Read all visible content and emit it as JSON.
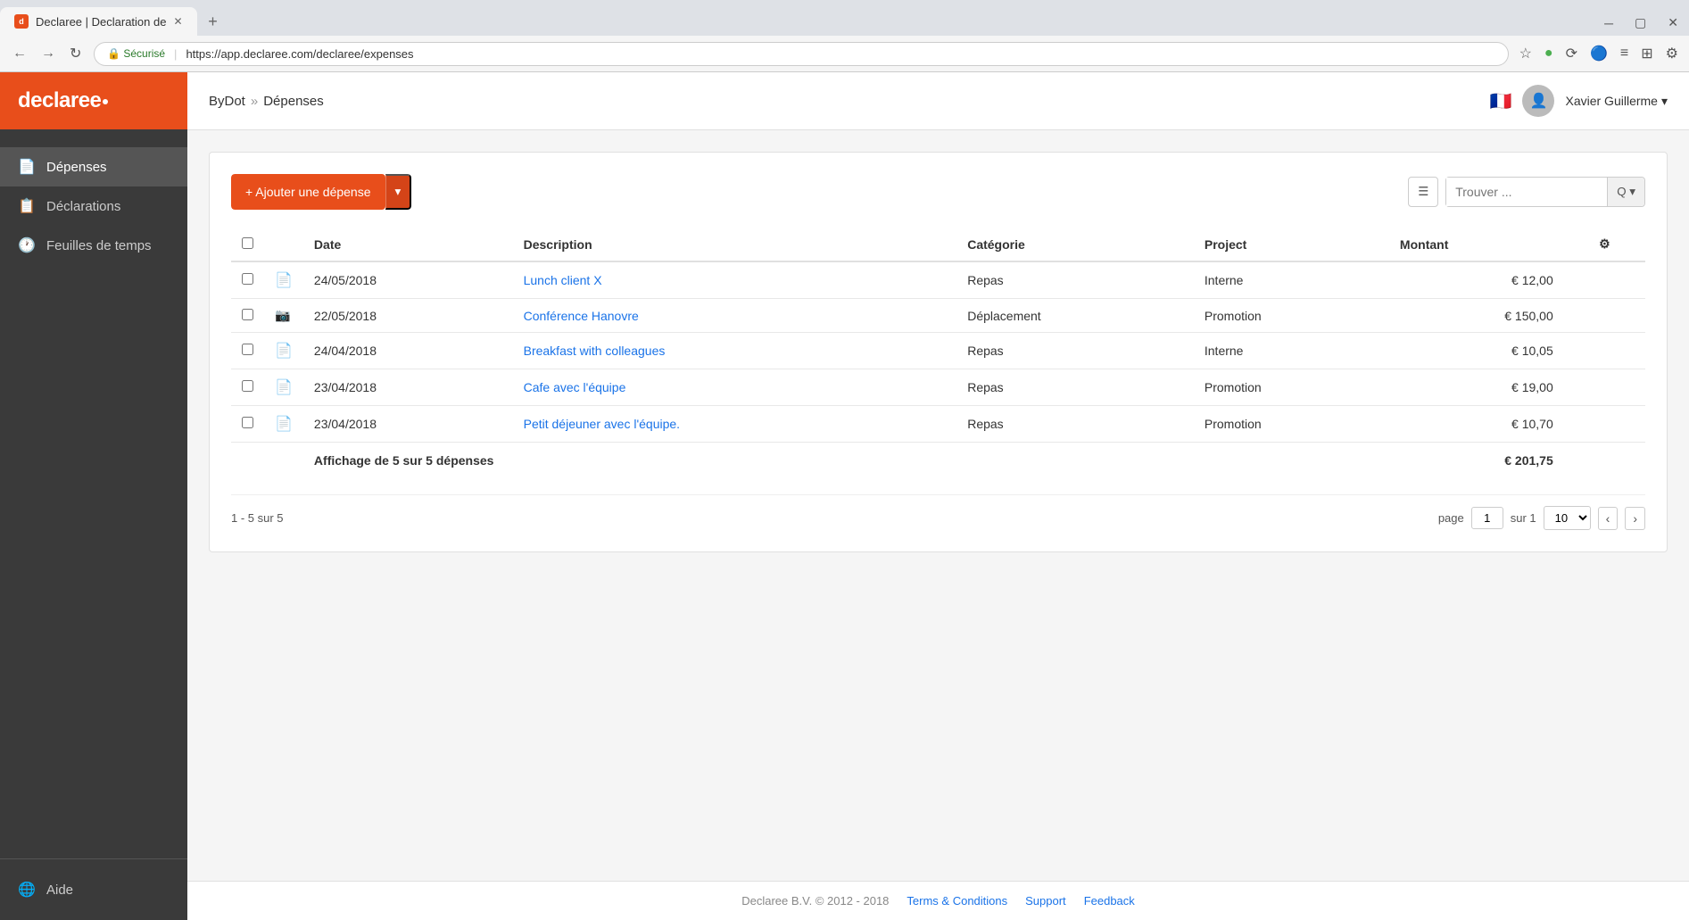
{
  "browser": {
    "tab_title": "Declaree | Declaration de",
    "url": "https://app.declaree.com/declaree/expenses",
    "secure_label": "Sécurisé"
  },
  "sidebar": {
    "logo": "declaree",
    "items": [
      {
        "id": "depenses",
        "label": "Dépenses",
        "icon": "📄",
        "active": true
      },
      {
        "id": "declarations",
        "label": "Déclarations",
        "icon": "📋",
        "active": false
      },
      {
        "id": "feuilles",
        "label": "Feuilles de temps",
        "icon": "🕐",
        "active": false
      }
    ],
    "bottom_items": [
      {
        "id": "aide",
        "label": "Aide",
        "icon": "🌐"
      }
    ]
  },
  "header": {
    "breadcrumb_org": "ByDot",
    "breadcrumb_sep": "»",
    "breadcrumb_page": "Dépenses",
    "user_name": "Xavier Guillerme",
    "flag": "🇫🇷"
  },
  "toolbar": {
    "add_button_label": "+ Ajouter une dépense",
    "search_placeholder": "Trouver ...",
    "search_btn_label": "Q▾"
  },
  "table": {
    "columns": [
      "",
      "",
      "Date",
      "Description",
      "Catégorie",
      "Project",
      "Montant",
      "⚙"
    ],
    "rows": [
      {
        "icon": "doc",
        "date": "24/05/2018",
        "description": "Lunch client X",
        "categorie": "Repas",
        "project": "Interne",
        "montant": "€ 12,00"
      },
      {
        "icon": "camera",
        "date": "22/05/2018",
        "description": "Conférence Hanovre",
        "categorie": "Déplacement",
        "project": "Promotion",
        "montant": "€ 150,00"
      },
      {
        "icon": "doc",
        "date": "24/04/2018",
        "description": "Breakfast with colleagues",
        "categorie": "Repas",
        "project": "Interne",
        "montant": "€ 10,05"
      },
      {
        "icon": "doc",
        "date": "23/04/2018",
        "description": "Cafe avec l'équipe",
        "categorie": "Repas",
        "project": "Promotion",
        "montant": "€ 19,00"
      },
      {
        "icon": "doc",
        "date": "23/04/2018",
        "description": "Petit déjeuner avec l'équipe.",
        "categorie": "Repas",
        "project": "Promotion",
        "montant": "€ 10,70"
      }
    ],
    "summary_label": "Affichage de 5 sur 5 dépenses",
    "total": "€ 201,75"
  },
  "pagination": {
    "range_label": "1 - 5 sur 5",
    "page_label": "page",
    "page_value": "1",
    "of_label": "sur 1",
    "per_page_value": "10"
  },
  "footer": {
    "copyright": "Declaree B.V. © 2012 - 2018",
    "terms_label": "Terms & Conditions",
    "support_label": "Support",
    "feedback_label": "Feedback"
  }
}
